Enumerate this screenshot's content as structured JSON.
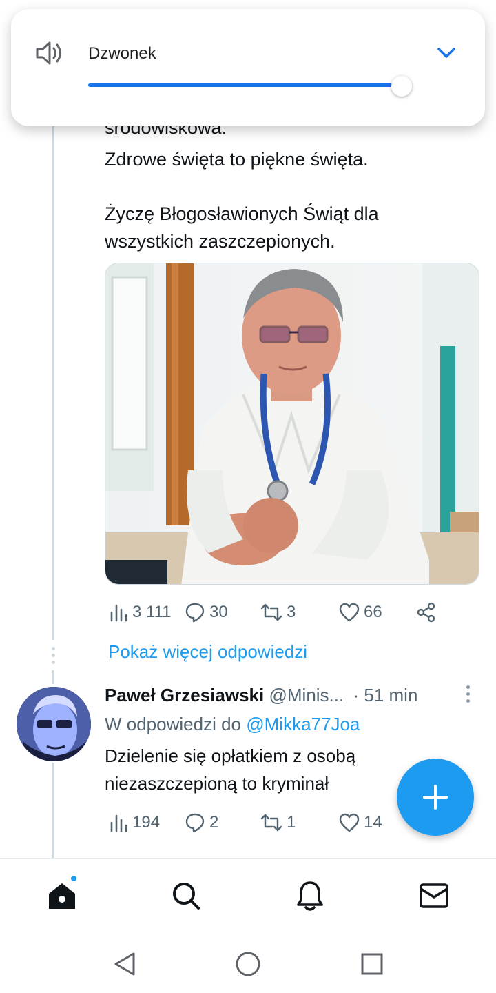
{
  "volume_panel": {
    "label": "Dzwonek",
    "level_fraction": 0.97,
    "accent_color": "#1a73e8"
  },
  "tweet": {
    "text_lines": [
      "środowiskowa.",
      "Zdrowe święta to piękne święta.",
      "",
      "Życzę Błogosławionych Świąt dla",
      "wszystkich zaszczepionych."
    ],
    "media_description_icon": "photo",
    "stats": {
      "views": "3 111",
      "replies": "30",
      "retweets": "3",
      "likes": "66"
    }
  },
  "more_replies_link": "Pokaż więcej odpowiedzi",
  "reply": {
    "name": "Paweł Grzesiawski",
    "handle": "@Minis...",
    "separator": "·",
    "time": "51 min",
    "reply_to_prefix": "W odpowiedzi do",
    "reply_to_mention": "@Mikka77Joa",
    "text_lines": [
      "Dzielenie się opłatkiem z osobą",
      "niezaszczepioną to kryminał"
    ],
    "stats": {
      "views": "194",
      "replies": "2",
      "retweets": "1",
      "likes": "14"
    }
  },
  "icons": {
    "speaker": "speaker-icon",
    "chevron": "chevron-down-icon",
    "views": "bar-chart-icon",
    "reply": "comment-icon",
    "retweet": "retweet-icon",
    "like": "heart-icon",
    "share": "share-icon",
    "compose": "plus-icon",
    "home": "home-icon",
    "search": "search-icon",
    "notifications": "bell-icon",
    "messages": "mail-icon"
  },
  "colors": {
    "link": "#1d9bf0",
    "muted": "#536471",
    "text": "#0f1419"
  }
}
